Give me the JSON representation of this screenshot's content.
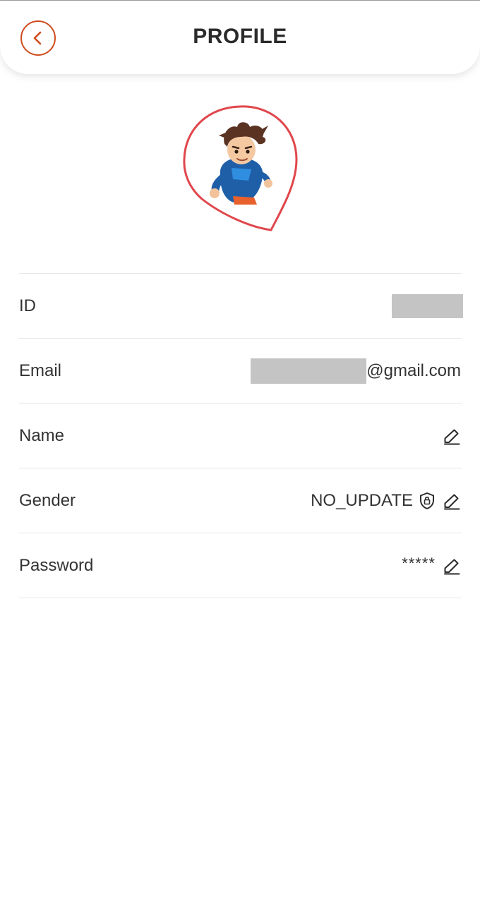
{
  "header": {
    "title": "PROFILE",
    "back_icon": "chevron-left-icon",
    "accent_color": "#cf4b1c"
  },
  "avatar": {
    "frame_color": "#e0474c",
    "description": "cartoon-boy-avatar"
  },
  "profile_rows": [
    {
      "label": "ID",
      "value": ""
    },
    {
      "label": "Email",
      "value": "@gmail.com"
    },
    {
      "label": "Name",
      "value": ""
    },
    {
      "label": "Gender",
      "value": "NO_UPDATE"
    },
    {
      "label": "Password",
      "value": "*****"
    }
  ]
}
